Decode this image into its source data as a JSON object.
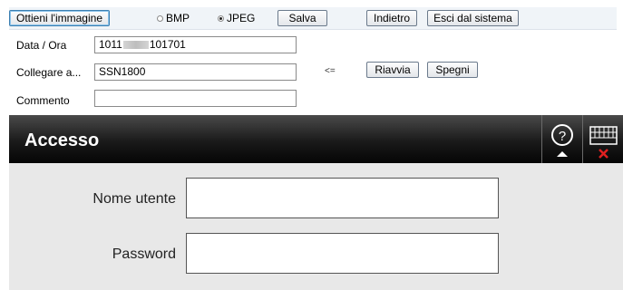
{
  "toolbar": {
    "capture_label": "Ottieni l'immagine",
    "format_bmp": "BMP",
    "format_jpeg": "JPEG",
    "selected_format": "JPEG",
    "save_label": "Salva",
    "back_label": "Indietro",
    "exit_label": "Esci dal sistema",
    "datetime_label": "Data / Ora",
    "datetime_prefix": "1011",
    "datetime_suffix": "101701",
    "connect_label": "Collegare a...",
    "connect_value": "SSN1800",
    "arrow": "<=",
    "restart_label": "Riavvia",
    "shutdown_label": "Spegni",
    "comment_label": "Commento",
    "comment_value": ""
  },
  "login": {
    "title": "Accesso",
    "username_label": "Nome utente",
    "password_label": "Password",
    "username_value": "",
    "password_value": ""
  },
  "icons": {
    "help": "help-icon",
    "keyboard": "keyboard-icon"
  },
  "colors": {
    "header_dark": "#1a1a1a",
    "panel_bg": "#e8e8e8",
    "close_red": "#e02020"
  }
}
